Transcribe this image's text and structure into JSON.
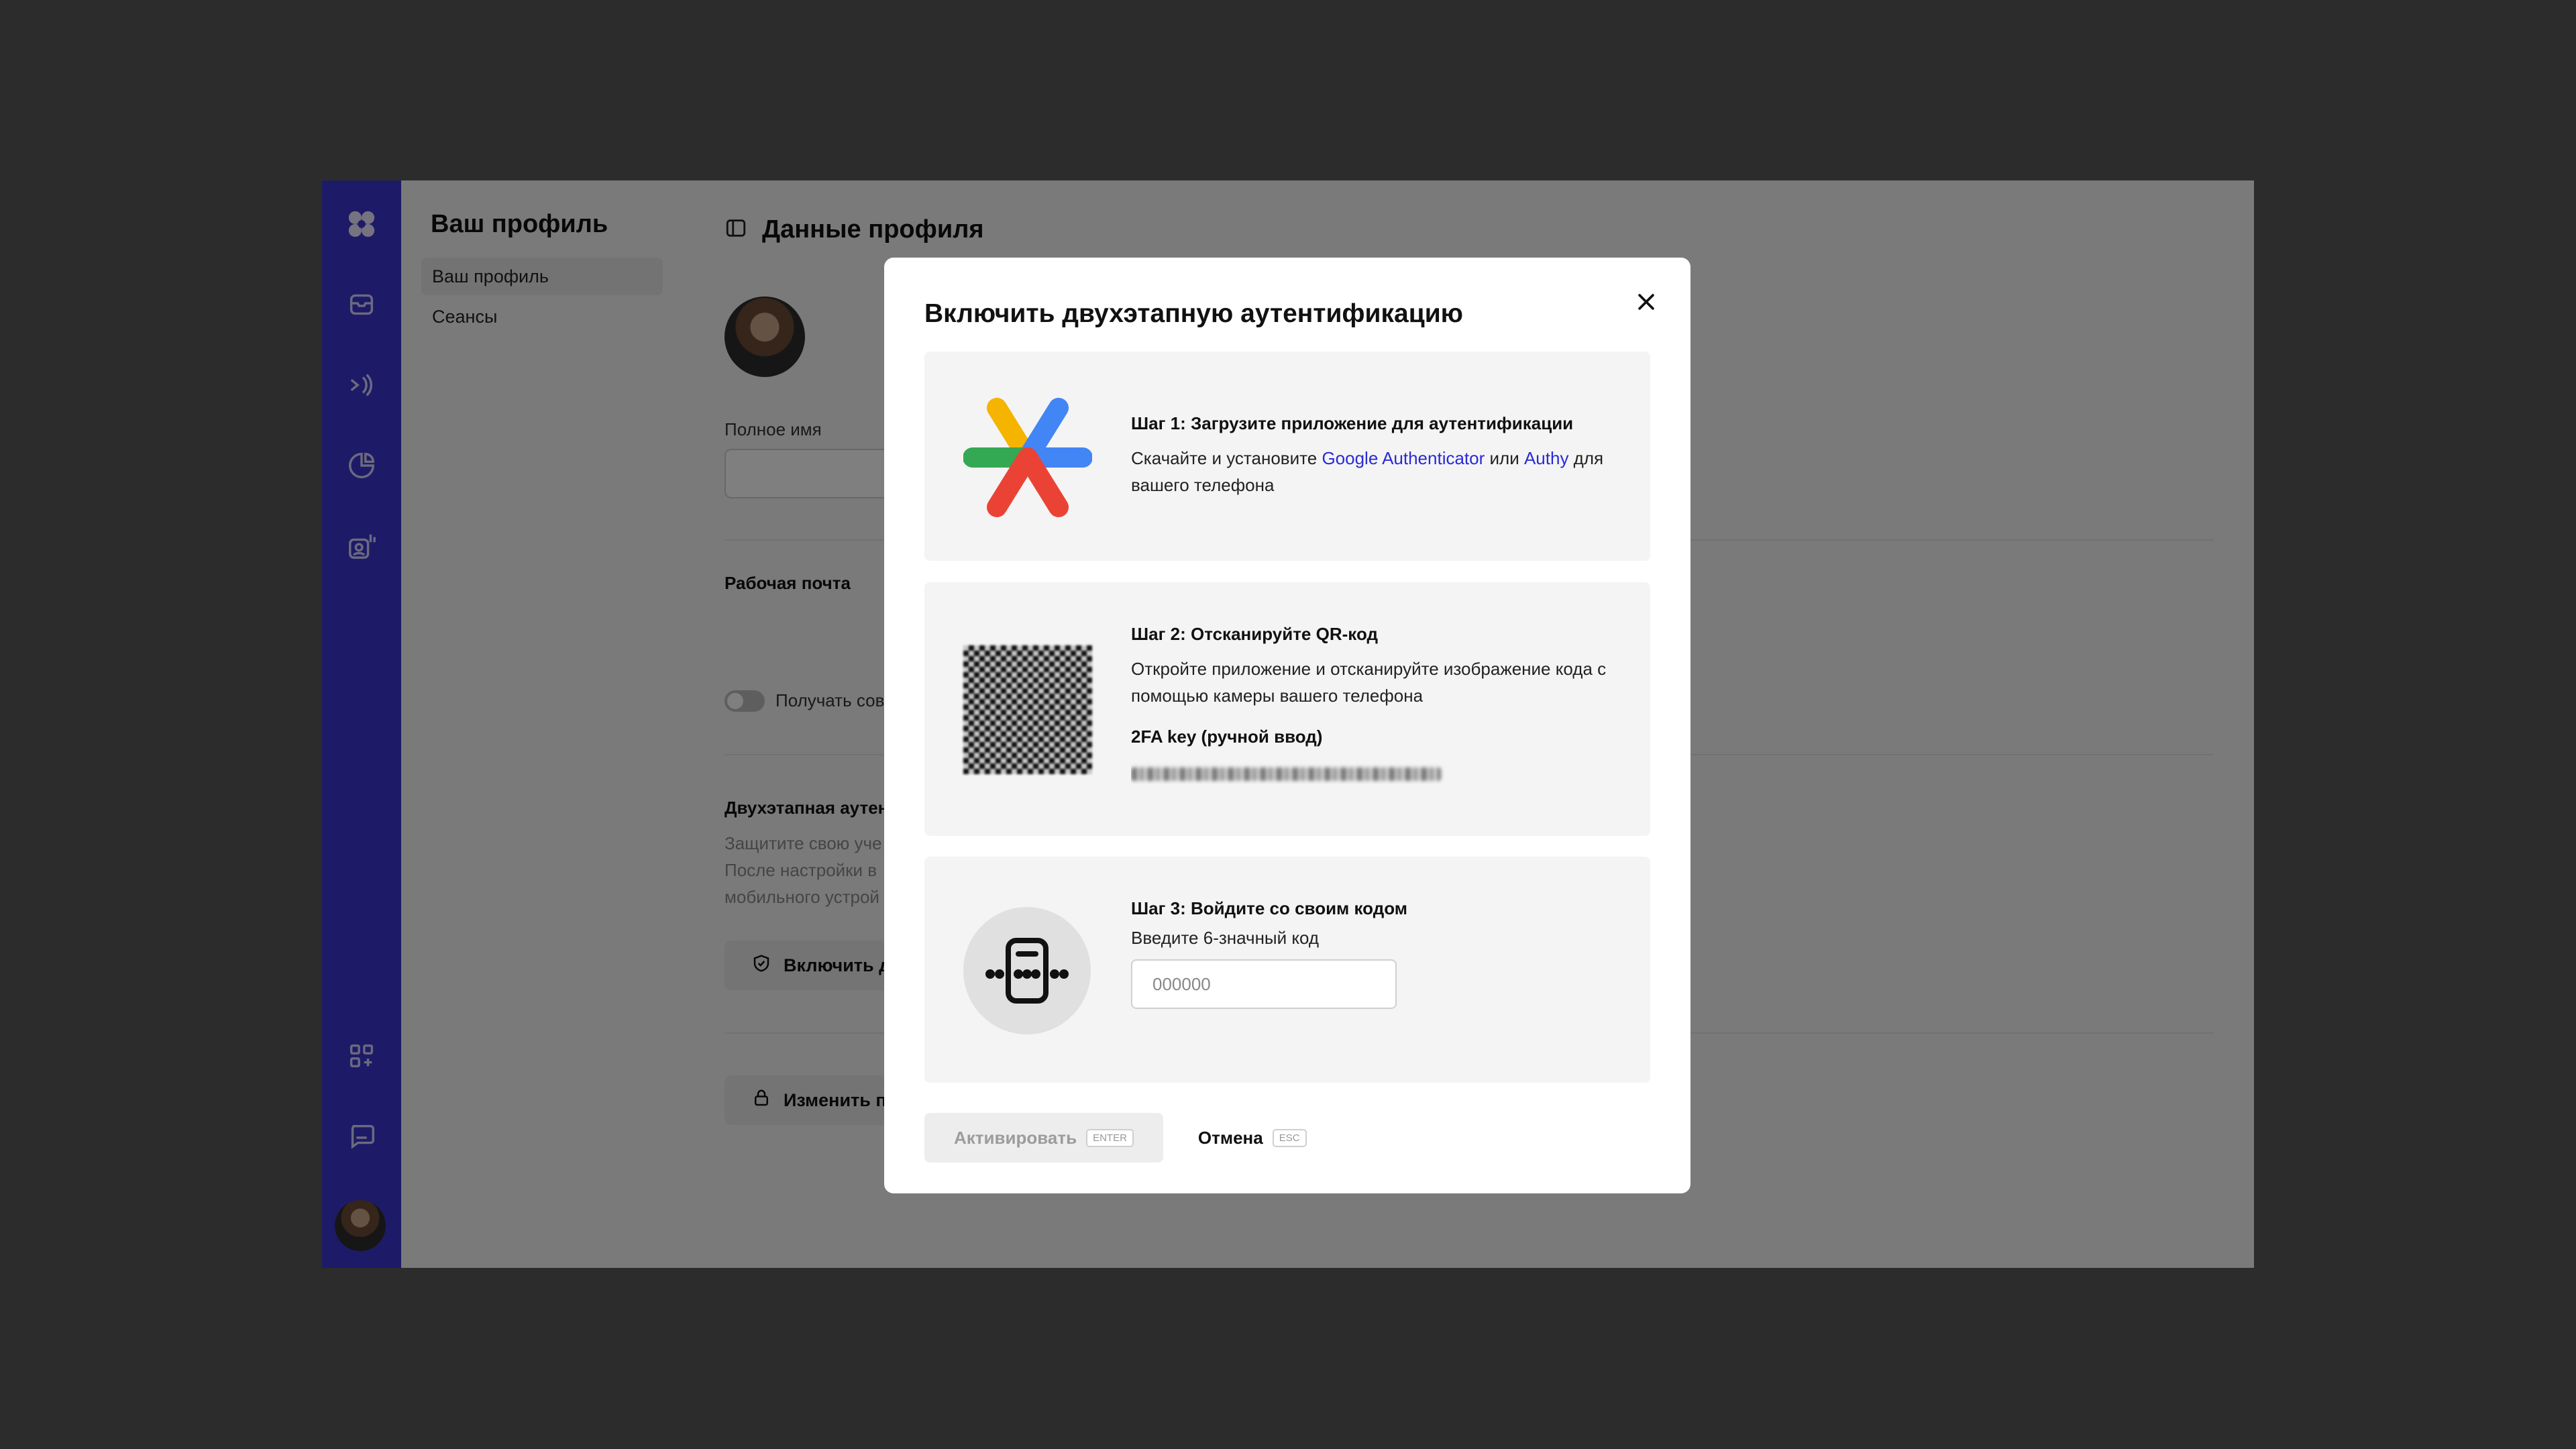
{
  "sidebar": {
    "title": "Ваш профиль",
    "items": [
      {
        "label": "Ваш профиль",
        "active": true
      },
      {
        "label": "Сеансы",
        "active": false
      }
    ]
  },
  "main": {
    "title": "Данные профиля",
    "full_name_label": "Полное имя",
    "work_email_label": "Рабочая почта",
    "toggle_label_partial": "Получать сов",
    "two_factor_heading_partial": "Двухэтапная аутент",
    "two_factor_desc_partial": [
      "Защитите свою уче",
      "После настройки в",
      "мобильного устрой"
    ],
    "enable_button_partial": "Включить д",
    "change_password_partial": "Изменить па"
  },
  "modal": {
    "title": "Включить двухэтапную аутентификацию",
    "step1": {
      "heading": "Шаг 1: Загрузите приложение для аутентификации",
      "desc_before": "Скачайте и установите ",
      "link1": "Google Authenticator",
      "desc_mid": " или ",
      "link2": "Authy",
      "desc_after": " для вашего телефона"
    },
    "step2": {
      "heading": "Шаг 2: Отсканируйте QR-код",
      "desc": "Откройте приложение и отсканируйте изображение кода с помощью камеры вашего телефона",
      "key_label": "2FA key (ручной ввод)"
    },
    "step3": {
      "heading": "Шаг 3: Войдите со своим кодом",
      "input_label": "Введите 6-значный код",
      "input_placeholder": "000000"
    },
    "activate_label": "Активировать",
    "activate_kbd": "ENTER",
    "cancel_label": "Отмена",
    "cancel_kbd": "ESC"
  },
  "colors": {
    "rail": "#3b36cf",
    "link": "#2a2ad6",
    "overlay": "rgba(0,0,0,0.5)"
  },
  "icons": [
    "app-logo-icon",
    "inbox-icon",
    "broadcast-icon",
    "chart-icon",
    "contacts-icon",
    "apps-icon",
    "chat-icon",
    "panel-icon",
    "shield-icon",
    "lock-icon",
    "close-icon",
    "authenticator-logo-icon",
    "code-icon"
  ]
}
